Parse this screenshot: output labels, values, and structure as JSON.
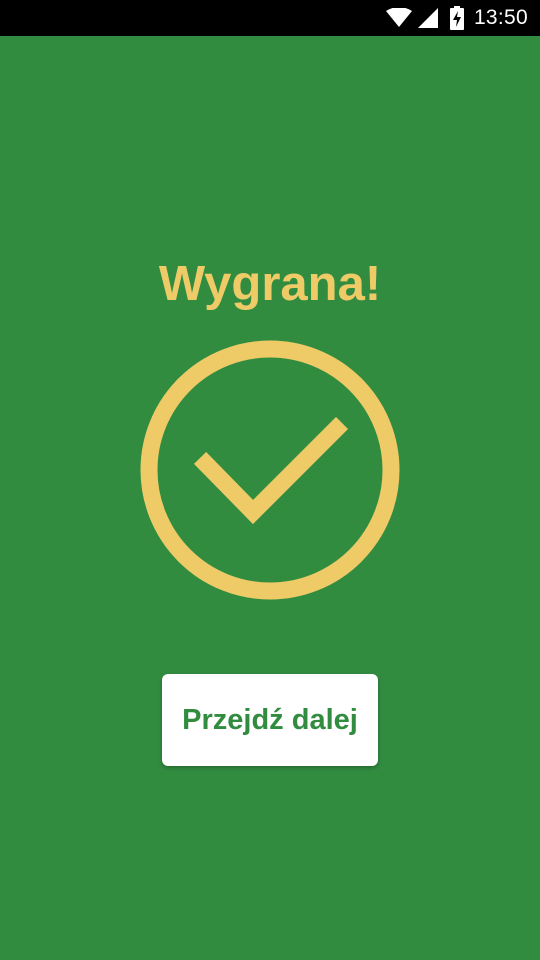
{
  "status_bar": {
    "time": "13:50",
    "icons": [
      "wifi-icon",
      "cell-signal-icon",
      "battery-charging-icon"
    ]
  },
  "result": {
    "title": "Wygrana!",
    "icon": "check-circle-icon"
  },
  "actions": {
    "continue_label": "Przejdź dalej"
  },
  "colors": {
    "background": "#318C40",
    "accent": "#EFCB68",
    "button_background": "#FFFFFF",
    "button_text": "#318C40",
    "status_bar": "#000000"
  }
}
